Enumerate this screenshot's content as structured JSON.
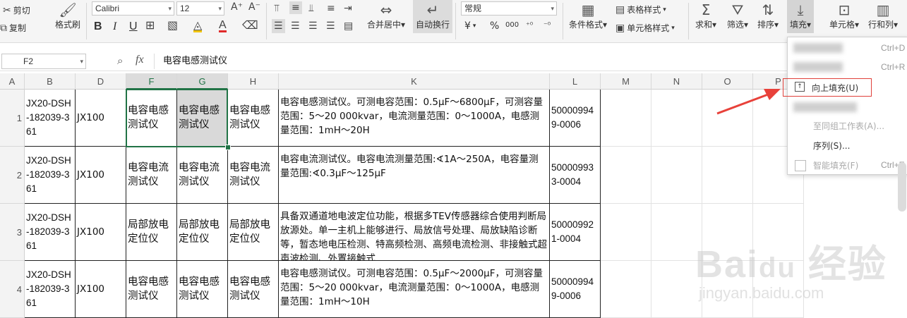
{
  "ribbon": {
    "cut": "剪切",
    "copy": "复制",
    "format_painter": "格式刷",
    "font_name": "Calibri",
    "font_size": "12",
    "bold": "B",
    "italic": "I",
    "underline": "U",
    "merge_center": "合并居中",
    "wrap_text": "自动换行",
    "number_format": "常规",
    "currency": "¥",
    "percent": "%",
    "thousands": "000",
    "conditional_format": "条件格式",
    "table_style": "表格样式",
    "cell_style": "单元格样式",
    "sum": "求和",
    "filter": "筛选",
    "sort": "排序",
    "fill": "填充",
    "cells": "单元格",
    "rows_cols": "行和列"
  },
  "formula_bar": {
    "name_box": "F2",
    "fx": "fx",
    "content": "电容电感测试仪"
  },
  "columns": [
    "A",
    "B",
    "D",
    "F",
    "G",
    "H",
    "K",
    "L",
    "M",
    "N",
    "O",
    "P"
  ],
  "rows": [
    {
      "num": "1",
      "B": "JX20-DSH-182039-361",
      "D": "JX100",
      "F": "电容电感测试仪",
      "G": "电容电感测试仪",
      "H": "电容电感测试仪",
      "K": "电容电感测试仪。可测电容范围：0.5μF～6800μF，可测容量范围：5～20 000kvar，电流测量范围：0～1000A，电感测量范围：1mH～20H",
      "L": "500009949-0006"
    },
    {
      "num": "2",
      "B": "JX20-DSH-182039-361",
      "D": "JX100",
      "F": "电容电流测试仪",
      "G": "电容电流测试仪",
      "H": "电容电流测试仪",
      "K": "电容电流测试仪。电容电流测量范围:∢1A～250A，电容量测量范围:∢0.3μF～125μF",
      "L": "500009933-0004"
    },
    {
      "num": "3",
      "B": "JX20-DSH-182039-361",
      "D": "JX100",
      "F": "局部放电定位仪",
      "G": "局部放电定位仪",
      "H": "局部放电定位仪",
      "K": "具备双通道地电波定位功能，根据多TEV传感器综合使用判断局放源处。单一主机上能够进行、局放信号处理、局放缺陷诊断等，暂态地电压检测、特高频检测、高频电流检测、非接触式超声波检测、外置接触式",
      "L": "500009921-0004"
    },
    {
      "num": "4",
      "B": "JX20-DSH-182039-361",
      "D": "JX100",
      "F": "电容电感测试仪",
      "G": "电容电感测试仪",
      "H": "电容电感测试仪",
      "K": "电容电感测试仪。可测电容范围：0.5μF～2000μF，可测容量范围：5～20 000kvar，电流测量范围：0～1000A，电感测量范围：1mH～10H",
      "L": "500009949-0006"
    }
  ],
  "fill_menu": {
    "items": [
      {
        "label": "",
        "shortcut": "Ctrl+D",
        "state": "blurred"
      },
      {
        "label": "",
        "shortcut": "Ctrl+R",
        "state": "blurred"
      },
      {
        "label": "向上填充(U)",
        "shortcut": "",
        "state": "highlighted"
      },
      {
        "label": "",
        "shortcut": "",
        "state": "blurred"
      },
      {
        "label": "至同组工作表(A)...",
        "shortcut": "",
        "state": "disabled"
      },
      {
        "label": "序列(S)...",
        "shortcut": "",
        "state": "normal"
      },
      {
        "label": "智能填充(F)",
        "shortcut": "Ctrl+E",
        "state": "disabled"
      }
    ]
  },
  "colors": {
    "selection": "#217346",
    "highlight_box": "#e0403a",
    "arrow": "#e8413a",
    "ribbon_bg": "#f5f5f5",
    "header_bg": "#f3f3f3"
  }
}
